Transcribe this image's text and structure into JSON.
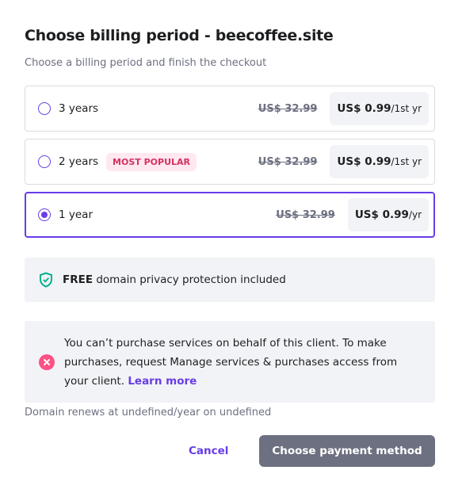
{
  "title": "Choose billing period - beecoffee.site",
  "subtitle": "Choose a billing period and finish the checkout",
  "plans": [
    {
      "label": "3 years",
      "badge": "",
      "old_price": "US$ 32.99",
      "price": "US$ 0.99",
      "period": "/1st yr",
      "selected": false
    },
    {
      "label": "2 years",
      "badge": "MOST POPULAR",
      "old_price": "US$ 32.99",
      "price": "US$ 0.99",
      "period": "/1st yr",
      "selected": false
    },
    {
      "label": "1 year",
      "badge": "",
      "old_price": "US$ 32.99",
      "price": "US$ 0.99",
      "period": "/yr",
      "selected": true
    }
  ],
  "privacy": {
    "bold": "FREE",
    "text": " domain privacy protection included",
    "icon": "shield-check-icon"
  },
  "error": {
    "text": "You can’t purchase services on behalf of this client. To make purchases, request Manage services & purchases access from your client. ",
    "link": "Learn more",
    "icon": "error-x-icon"
  },
  "renew": "Domain renews at undefined/year on undefined",
  "buttons": {
    "cancel": "Cancel",
    "pay": "Choose payment method"
  },
  "colors": {
    "accent": "#673de6",
    "danger": "#fc5185",
    "success": "#00b090"
  }
}
